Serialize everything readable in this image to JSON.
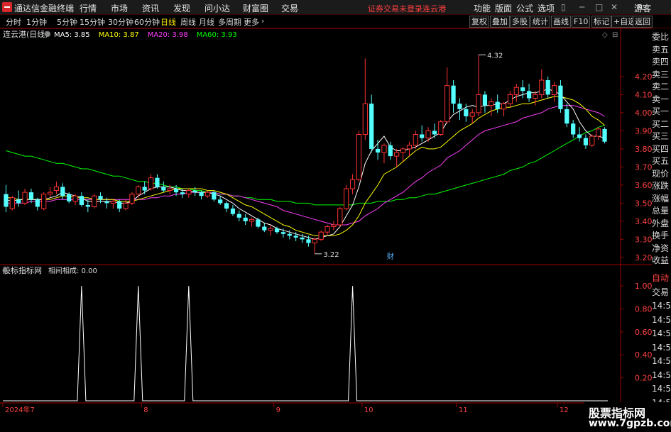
{
  "app": {
    "title": "通达信金融终端",
    "menu": [
      "行情",
      "市场",
      "资讯",
      "发现",
      "问小达",
      "财富圈",
      "交易"
    ],
    "notice": "证券交易未登录",
    "stock_name": "连云港",
    "right_menu": [
      "功能",
      "版面",
      "公式",
      "选项"
    ],
    "guest": "游客",
    "r_badge": "R"
  },
  "periods": [
    "分时",
    "1分钟",
    "5分钟",
    "15分钟",
    "30分钟",
    "60分钟",
    "日线",
    "周线",
    "月线",
    "多周期",
    "更多"
  ],
  "active_period": "日线",
  "toolbar": [
    "复权",
    "叠加",
    "多股",
    "统计",
    "画线",
    "F10",
    "标记",
    "+自选",
    "返回"
  ],
  "main_legend": {
    "title": "连云港(日线)",
    "ma": [
      {
        "label": "MA5: 3.85",
        "color": "#ffffff"
      },
      {
        "label": "MA10: 3.87",
        "color": "#ffff00"
      },
      {
        "label": "MA20: 3.98",
        "color": "#ff40ff"
      },
      {
        "label": "MA60: 3.93",
        "color": "#00ff00"
      }
    ]
  },
  "sub_legend": {
    "title": "股标指标网",
    "indicator": "相间相成: 0.00"
  },
  "annotations": {
    "high": "4.32",
    "low": "3.22",
    "finance_marker": "财"
  },
  "price_axis": [
    "4.20",
    "4.10",
    "4.00",
    "3.90",
    "3.80",
    "3.70",
    "3.60",
    "3.50",
    "3.40",
    "3.30",
    "3.20"
  ],
  "indicator_axis": [
    "1.00",
    "0.80",
    "0.60",
    "0.40",
    "0.20"
  ],
  "date_axis": [
    "2024年7",
    "8",
    "9",
    "10",
    "11",
    "12"
  ],
  "side_panel_top": [
    "委比",
    "卖五",
    "卖四",
    "卖三",
    "卖二",
    "卖一",
    "买一",
    "买二",
    "买三",
    "买四",
    "买五",
    "现价",
    "涨跌",
    "涨幅",
    "总量",
    "外盘",
    "换手",
    "净资",
    "收益"
  ],
  "side_panel_bottom": [
    "自动",
    "交易",
    "14:56",
    "14:56",
    "14:56",
    "14:56",
    "14:56",
    "14:56",
    "14:56",
    "14:56"
  ],
  "watermark": {
    "line1": "股票指标网",
    "line2": "www.7gpzb.com"
  },
  "colors": {
    "up": "#ff3232",
    "down": "#54ffff",
    "ma5": "#ffffff",
    "ma10": "#ffff00",
    "ma20": "#ff40ff",
    "ma60": "#00ff00",
    "grid": "#8b0000",
    "panel_border": "#a00000"
  },
  "icons": [
    "logo-icon",
    "minimize-icon",
    "maximize-icon",
    "close-icon",
    "settings-icon",
    "collapse-icon"
  ],
  "chart_data": {
    "type": "candlestick",
    "main": {
      "ylim": [
        3.18,
        4.38
      ],
      "ohlc": [
        [
          3.55,
          3.6,
          3.45,
          3.48
        ],
        [
          3.47,
          3.54,
          3.46,
          3.53
        ],
        [
          3.52,
          3.57,
          3.48,
          3.5
        ],
        [
          3.5,
          3.58,
          3.49,
          3.56
        ],
        [
          3.56,
          3.58,
          3.5,
          3.52
        ],
        [
          3.52,
          3.53,
          3.46,
          3.48
        ],
        [
          3.47,
          3.56,
          3.46,
          3.55
        ],
        [
          3.55,
          3.59,
          3.53,
          3.56
        ],
        [
          3.57,
          3.62,
          3.55,
          3.59
        ],
        [
          3.59,
          3.61,
          3.52,
          3.54
        ],
        [
          3.55,
          3.56,
          3.5,
          3.51
        ],
        [
          3.51,
          3.55,
          3.49,
          3.54
        ],
        [
          3.54,
          3.56,
          3.48,
          3.49
        ],
        [
          3.49,
          3.52,
          3.45,
          3.48
        ],
        [
          3.48,
          3.55,
          3.47,
          3.54
        ],
        [
          3.54,
          3.56,
          3.5,
          3.52
        ],
        [
          3.51,
          3.53,
          3.47,
          3.5
        ],
        [
          3.5,
          3.52,
          3.47,
          3.51
        ],
        [
          3.51,
          3.52,
          3.45,
          3.47
        ],
        [
          3.47,
          3.52,
          3.46,
          3.5
        ],
        [
          3.5,
          3.56,
          3.49,
          3.55
        ],
        [
          3.55,
          3.6,
          3.53,
          3.59
        ],
        [
          3.59,
          3.62,
          3.55,
          3.57
        ],
        [
          3.58,
          3.66,
          3.57,
          3.64
        ],
        [
          3.64,
          3.66,
          3.58,
          3.59
        ],
        [
          3.59,
          3.62,
          3.56,
          3.57
        ],
        [
          3.57,
          3.6,
          3.55,
          3.58
        ],
        [
          3.58,
          3.6,
          3.54,
          3.56
        ],
        [
          3.56,
          3.58,
          3.53,
          3.55
        ],
        [
          3.55,
          3.58,
          3.53,
          3.57
        ],
        [
          3.57,
          3.59,
          3.54,
          3.56
        ],
        [
          3.56,
          3.57,
          3.52,
          3.54
        ],
        [
          3.54,
          3.57,
          3.53,
          3.56
        ],
        [
          3.56,
          3.57,
          3.51,
          3.52
        ],
        [
          3.52,
          3.54,
          3.49,
          3.5
        ],
        [
          3.5,
          3.51,
          3.45,
          3.47
        ],
        [
          3.47,
          3.49,
          3.43,
          3.44
        ],
        [
          3.44,
          3.46,
          3.4,
          3.42
        ],
        [
          3.42,
          3.44,
          3.38,
          3.4
        ],
        [
          3.4,
          3.42,
          3.37,
          3.41
        ],
        [
          3.41,
          3.42,
          3.36,
          3.37
        ],
        [
          3.37,
          3.39,
          3.34,
          3.35
        ],
        [
          3.35,
          3.38,
          3.32,
          3.36
        ],
        [
          3.36,
          3.37,
          3.33,
          3.34
        ],
        [
          3.34,
          3.36,
          3.31,
          3.33
        ],
        [
          3.33,
          3.35,
          3.3,
          3.32
        ],
        [
          3.32,
          3.34,
          3.29,
          3.31
        ],
        [
          3.31,
          3.33,
          3.28,
          3.3
        ],
        [
          3.3,
          3.32,
          3.26,
          3.28
        ],
        [
          3.28,
          3.31,
          3.22,
          3.3
        ],
        [
          3.3,
          3.35,
          3.29,
          3.34
        ],
        [
          3.34,
          3.38,
          3.32,
          3.37
        ],
        [
          3.37,
          3.4,
          3.35,
          3.38
        ],
        [
          3.38,
          3.48,
          3.37,
          3.47
        ],
        [
          3.47,
          3.6,
          3.46,
          3.58
        ],
        [
          3.58,
          3.66,
          3.55,
          3.63
        ],
        [
          3.63,
          3.9,
          3.62,
          3.88
        ],
        [
          3.88,
          4.3,
          3.85,
          4.05
        ],
        [
          4.05,
          4.1,
          3.78,
          3.8
        ],
        [
          3.8,
          3.85,
          3.74,
          3.78
        ],
        [
          3.78,
          3.83,
          3.72,
          3.82
        ],
        [
          3.82,
          3.84,
          3.74,
          3.76
        ],
        [
          3.76,
          3.8,
          3.7,
          3.78
        ],
        [
          3.78,
          3.81,
          3.73,
          3.8
        ],
        [
          3.8,
          3.84,
          3.76,
          3.82
        ],
        [
          3.82,
          3.9,
          3.8,
          3.88
        ],
        [
          3.88,
          3.93,
          3.84,
          3.86
        ],
        [
          3.86,
          3.92,
          3.84,
          3.9
        ],
        [
          3.9,
          3.94,
          3.86,
          3.88
        ],
        [
          3.88,
          3.96,
          3.87,
          3.95
        ],
        [
          3.95,
          4.25,
          3.94,
          4.15
        ],
        [
          4.15,
          4.18,
          4.0,
          4.05
        ],
        [
          4.05,
          4.08,
          3.96,
          4.02
        ],
        [
          4.02,
          4.05,
          3.95,
          3.98
        ],
        [
          3.98,
          4.02,
          3.94,
          4.0
        ],
        [
          4.0,
          4.32,
          3.98,
          4.1
        ],
        [
          4.1,
          4.12,
          4.0,
          4.04
        ],
        [
          4.04,
          4.08,
          3.98,
          4.06
        ],
        [
          4.06,
          4.1,
          4.0,
          4.02
        ],
        [
          4.02,
          4.06,
          3.98,
          4.05
        ],
        [
          4.05,
          4.12,
          4.03,
          4.1
        ],
        [
          4.1,
          4.16,
          4.06,
          4.14
        ],
        [
          4.14,
          4.18,
          4.08,
          4.12
        ],
        [
          4.12,
          4.16,
          4.06,
          4.08
        ],
        [
          4.08,
          4.12,
          4.04,
          4.1
        ],
        [
          4.1,
          4.24,
          4.08,
          4.18
        ],
        [
          4.18,
          4.2,
          4.08,
          4.1
        ],
        [
          4.1,
          4.17,
          4.06,
          4.15
        ],
        [
          4.15,
          4.18,
          4.0,
          4.02
        ],
        [
          4.02,
          4.05,
          3.92,
          3.94
        ],
        [
          3.94,
          3.96,
          3.86,
          3.88
        ],
        [
          3.88,
          3.92,
          3.84,
          3.86
        ],
        [
          3.86,
          3.88,
          3.8,
          3.82
        ],
        [
          3.82,
          3.88,
          3.81,
          3.87
        ],
        [
          3.87,
          3.92,
          3.85,
          3.91
        ],
        [
          3.91,
          3.92,
          3.83,
          3.84
        ]
      ],
      "ma5": [
        3.52,
        3.51,
        3.52,
        3.52,
        3.52,
        3.52,
        3.52,
        3.53,
        3.54,
        3.56,
        3.55,
        3.54,
        3.53,
        3.51,
        3.51,
        3.51,
        3.51,
        3.51,
        3.5,
        3.5,
        3.51,
        3.54,
        3.56,
        3.58,
        3.59,
        3.59,
        3.59,
        3.58,
        3.57,
        3.57,
        3.56,
        3.56,
        3.56,
        3.55,
        3.54,
        3.52,
        3.5,
        3.47,
        3.45,
        3.43,
        3.41,
        3.39,
        3.38,
        3.36,
        3.35,
        3.34,
        3.33,
        3.32,
        3.31,
        3.3,
        3.31,
        3.32,
        3.33,
        3.37,
        3.43,
        3.49,
        3.59,
        3.72,
        3.79,
        3.83,
        3.87,
        3.81,
        3.79,
        3.79,
        3.8,
        3.81,
        3.83,
        3.85,
        3.87,
        3.89,
        3.95,
        3.99,
        4.01,
        4.03,
        4.04,
        4.03,
        4.04,
        4.04,
        4.05,
        4.05,
        4.07,
        4.09,
        4.1,
        4.11,
        4.11,
        4.12,
        4.13,
        4.12,
        4.1,
        4.06,
        4.02,
        3.95,
        3.9,
        3.87,
        3.87,
        3.86
      ],
      "ma10": [
        3.53,
        3.53,
        3.52,
        3.52,
        3.52,
        3.52,
        3.52,
        3.52,
        3.53,
        3.54,
        3.54,
        3.53,
        3.53,
        3.53,
        3.52,
        3.52,
        3.52,
        3.52,
        3.51,
        3.51,
        3.51,
        3.52,
        3.53,
        3.54,
        3.55,
        3.56,
        3.57,
        3.58,
        3.58,
        3.58,
        3.58,
        3.58,
        3.57,
        3.57,
        3.56,
        3.55,
        3.53,
        3.51,
        3.49,
        3.48,
        3.46,
        3.44,
        3.42,
        3.4,
        3.38,
        3.37,
        3.35,
        3.34,
        3.33,
        3.32,
        3.32,
        3.32,
        3.32,
        3.33,
        3.35,
        3.38,
        3.43,
        3.5,
        3.55,
        3.6,
        3.66,
        3.68,
        3.7,
        3.73,
        3.76,
        3.79,
        3.81,
        3.8,
        3.8,
        3.81,
        3.84,
        3.87,
        3.9,
        3.92,
        3.94,
        3.97,
        3.99,
        4.01,
        4.02,
        4.03,
        4.03,
        4.04,
        4.05,
        4.05,
        4.06,
        4.07,
        4.08,
        4.09,
        4.09,
        4.08,
        4.07,
        4.05,
        4.02,
        3.98,
        3.96,
        3.93
      ],
      "ma20": [
        3.5,
        3.5,
        3.5,
        3.5,
        3.51,
        3.51,
        3.51,
        3.51,
        3.52,
        3.52,
        3.52,
        3.52,
        3.52,
        3.52,
        3.52,
        3.52,
        3.52,
        3.52,
        3.52,
        3.52,
        3.52,
        3.52,
        3.52,
        3.53,
        3.53,
        3.54,
        3.54,
        3.55,
        3.55,
        3.56,
        3.56,
        3.56,
        3.56,
        3.56,
        3.55,
        3.55,
        3.54,
        3.54,
        3.53,
        3.52,
        3.51,
        3.5,
        3.49,
        3.48,
        3.46,
        3.45,
        3.44,
        3.43,
        3.42,
        3.41,
        3.4,
        3.39,
        3.38,
        3.38,
        3.38,
        3.39,
        3.4,
        3.43,
        3.45,
        3.47,
        3.5,
        3.52,
        3.54,
        3.56,
        3.59,
        3.62,
        3.64,
        3.67,
        3.69,
        3.71,
        3.75,
        3.77,
        3.79,
        3.82,
        3.85,
        3.88,
        3.9,
        3.91,
        3.92,
        3.93,
        3.94,
        3.95,
        3.97,
        3.98,
        3.99,
        4.0,
        4.02,
        4.03,
        4.04,
        4.04,
        4.04,
        4.03,
        4.02,
        4.01,
        4.0,
        3.98
      ],
      "ma60": [
        3.79,
        3.78,
        3.77,
        3.76,
        3.76,
        3.75,
        3.74,
        3.73,
        3.72,
        3.72,
        3.71,
        3.7,
        3.69,
        3.69,
        3.68,
        3.67,
        3.66,
        3.65,
        3.65,
        3.64,
        3.63,
        3.62,
        3.62,
        3.61,
        3.61,
        3.6,
        3.59,
        3.59,
        3.58,
        3.58,
        3.57,
        3.57,
        3.56,
        3.56,
        3.55,
        3.55,
        3.54,
        3.54,
        3.53,
        3.53,
        3.52,
        3.52,
        3.52,
        3.51,
        3.51,
        3.51,
        3.5,
        3.5,
        3.5,
        3.49,
        3.49,
        3.49,
        3.49,
        3.49,
        3.49,
        3.49,
        3.5,
        3.5,
        3.5,
        3.51,
        3.51,
        3.51,
        3.52,
        3.52,
        3.53,
        3.53,
        3.54,
        3.55,
        3.55,
        3.56,
        3.57,
        3.58,
        3.59,
        3.6,
        3.61,
        3.62,
        3.63,
        3.64,
        3.65,
        3.66,
        3.68,
        3.69,
        3.7,
        3.72,
        3.73,
        3.75,
        3.77,
        3.79,
        3.81,
        3.83,
        3.85,
        3.87,
        3.89,
        3.9,
        3.92,
        3.93
      ]
    },
    "indicator": {
      "ylim": [
        0,
        1.05
      ],
      "spikes_at": [
        12,
        21,
        29,
        55
      ],
      "values_desc": "0 everywhere except 1.00 at spike indices"
    },
    "date_ticks": [
      {
        "label": "2024年7",
        "index": 0
      },
      {
        "label": "8",
        "index": 22
      },
      {
        "label": "9",
        "index": 43
      },
      {
        "label": "10",
        "index": 57
      },
      {
        "label": "11",
        "index": 72
      },
      {
        "label": "12",
        "index": 88
      }
    ]
  }
}
